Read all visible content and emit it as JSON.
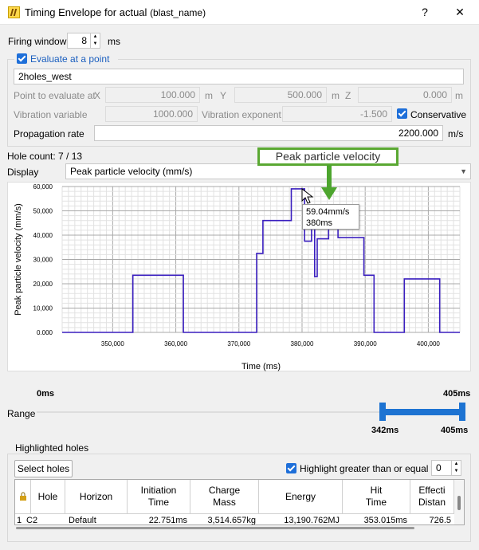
{
  "window": {
    "title": "Timing Envelope for actual",
    "title_suffix": "(blast_name)",
    "help_label": "?",
    "close_label": "✕"
  },
  "firing_window": {
    "label": "Firing window",
    "value": "8",
    "unit": "ms"
  },
  "evaluate": {
    "checkbox_label": "Evaluate at a point",
    "checked": true,
    "point_name": "2holes_west",
    "point_label": "Point to evaluate at",
    "x_label": "X",
    "x_value": "100.000",
    "x_unit": "m",
    "y_label": "Y",
    "y_value": "500.000",
    "y_unit": "m",
    "z_label": "Z",
    "z_value": "0.000",
    "z_unit": "m",
    "vib_var_label": "Vibration variable",
    "vib_var_value": "1000.000",
    "vib_exp_label": "Vibration exponent",
    "vib_exp_value": "-1.500",
    "conservative_label": "Conservative",
    "conservative_checked": true,
    "prop_rate_label": "Propagation rate",
    "prop_rate_value": "2200.000",
    "prop_rate_unit": "m/s"
  },
  "hole_count": "Hole count: 7 / 13",
  "display": {
    "label": "Display",
    "selected": "Peak particle velocity (mm/s)"
  },
  "annotation": {
    "callout": "Peak particle velocity"
  },
  "tooltip": {
    "value": "59.04mm/s",
    "time": "380ms"
  },
  "chart_data": {
    "type": "line",
    "xlabel": "Time (ms)",
    "ylabel": "Peak particle velocity (mm/s)",
    "xlim": [
      342,
      405
    ],
    "ylim": [
      0,
      60000
    ],
    "xticks": [
      350,
      360,
      370,
      380,
      390,
      400
    ],
    "xtick_labels": [
      "350,000",
      "360,000",
      "370,000",
      "380,000",
      "390,000",
      "400,000"
    ],
    "yticks": [
      0,
      10000,
      20000,
      30000,
      40000,
      50000,
      60000
    ],
    "ytick_labels": [
      "0.000",
      "10,000",
      "20,000",
      "30,000",
      "40,000",
      "50,000",
      "60,000"
    ],
    "grid": true,
    "series": [
      {
        "color": "#3a1fbf",
        "x": [
          342,
          353.2,
          353.2,
          361.2,
          361.2,
          372.8,
          372.8,
          373.8,
          373.8,
          378.3,
          378.3,
          380.4,
          380.4,
          381.5,
          381.5,
          382.0,
          382.0,
          382.4,
          382.4,
          384.2,
          384.2,
          385.7,
          385.7,
          389.8,
          389.8,
          391.4,
          391.4,
          396.2,
          396.2,
          401.8,
          401.8,
          405
        ],
        "y": [
          0,
          0,
          23500,
          23500,
          0,
          0,
          32500,
          32500,
          46000,
          46000,
          59040,
          59040,
          37500,
          37500,
          45000,
          45000,
          23000,
          23000,
          38500,
          38500,
          46500,
          46500,
          39000,
          39000,
          23500,
          23500,
          0,
          0,
          22000,
          22000,
          0,
          0
        ]
      }
    ]
  },
  "range": {
    "label": "Range",
    "min_label": "0ms",
    "max_label": "405ms",
    "low": 342,
    "high": 405,
    "low_label": "342ms",
    "high_label": "405ms",
    "total": 405
  },
  "highlighted": {
    "group_label": "Highlighted holes",
    "select_button": "Select holes",
    "highlight_label": "Highlight greater than or equal to",
    "highlight_checked": true,
    "threshold": "0"
  },
  "table": {
    "headers": [
      "Hole",
      "Horizon",
      "Initiation\nTime",
      "Charge\nMass",
      "Energy",
      "Hit\nTime",
      "Effecti\nDistan"
    ],
    "rows": [
      [
        "1",
        "C2",
        "Default",
        "22.751ms",
        "3,514.657kg",
        "13,190.762MJ",
        "353.015ms",
        "726.5"
      ]
    ]
  }
}
